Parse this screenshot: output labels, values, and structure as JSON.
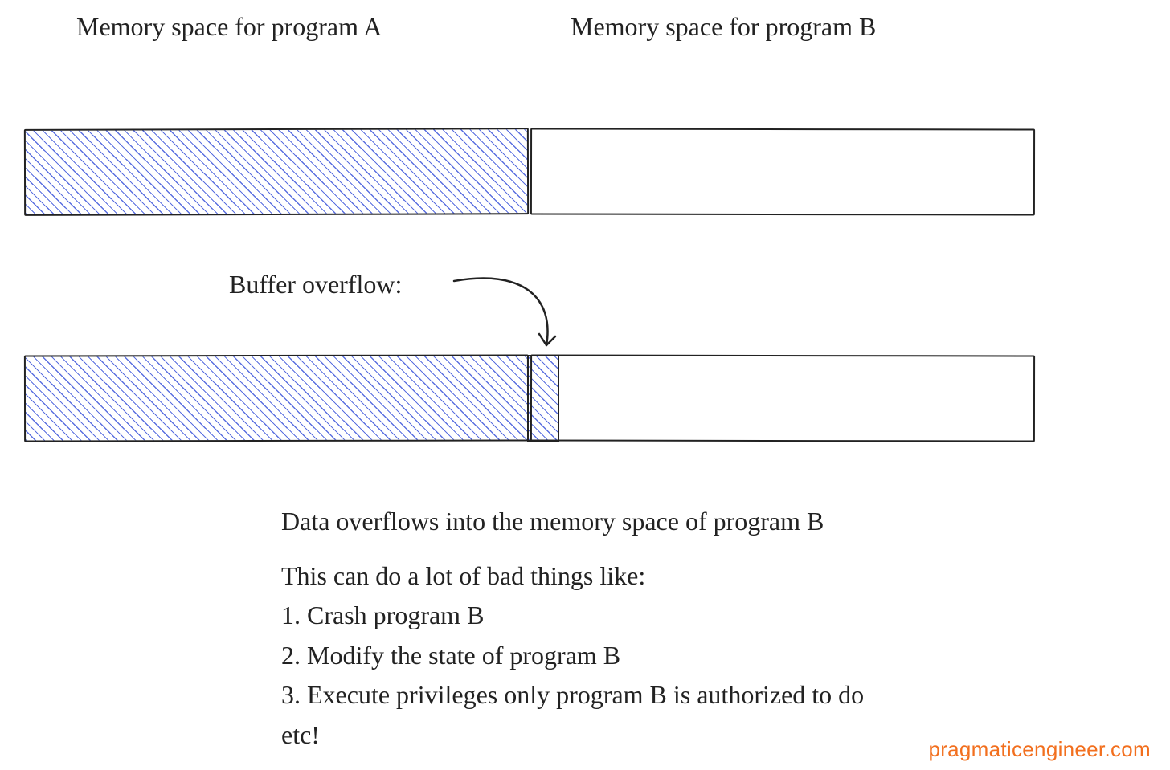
{
  "headings": {
    "programA": "Memory space for program A",
    "programB": "Memory space for program B"
  },
  "annotation": {
    "bufferOverflow": "Buffer overflow:"
  },
  "explanation": {
    "line1": "Data overflows into the memory space of program B",
    "line2": "This can do a lot of bad things like:",
    "item1": "1. Crash program B",
    "item2": "2. Modify the state of program B",
    "item3": "3. Execute privileges only program B is authorized to do",
    "etc": "etc!"
  },
  "watermark": "pragmaticengineer.com",
  "colors": {
    "hatch": "#5a6fe0",
    "ink": "#222222",
    "brand": "#f26f1e"
  }
}
